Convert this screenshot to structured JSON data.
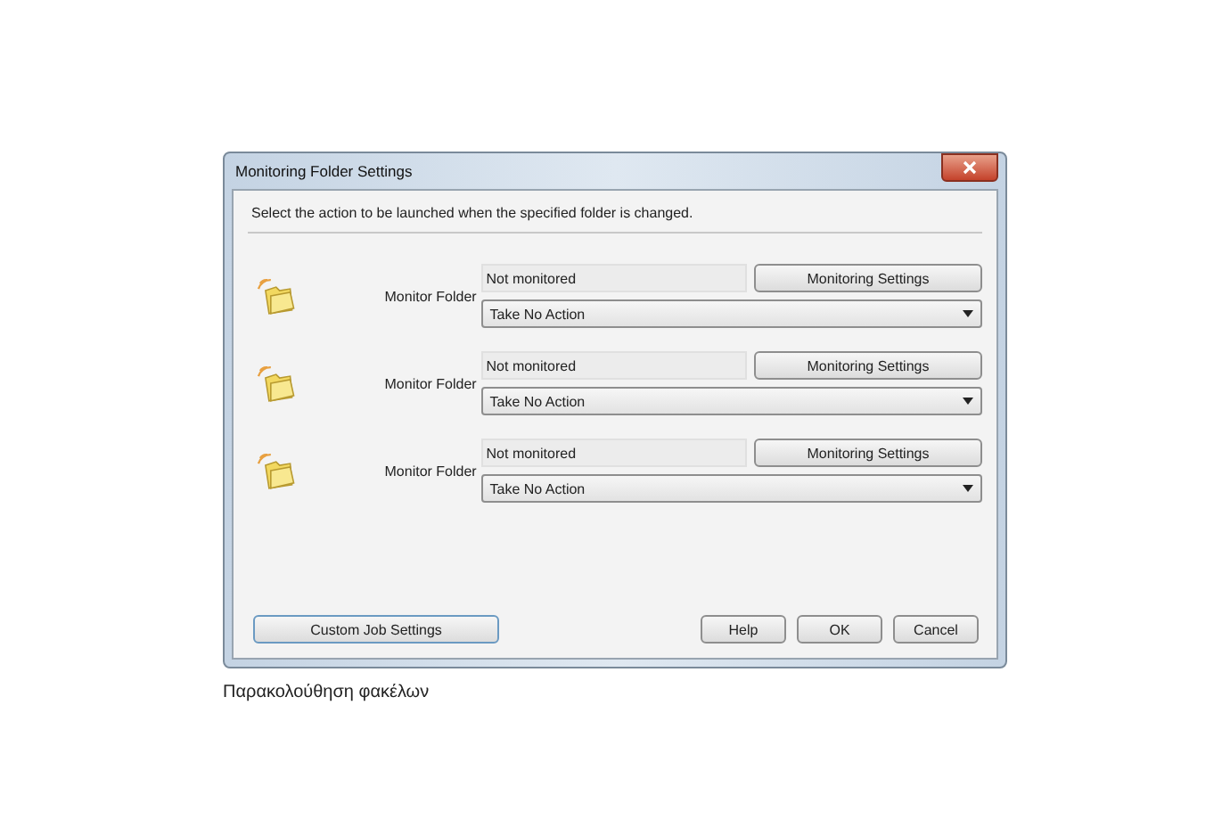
{
  "window": {
    "title": "Monitoring Folder Settings"
  },
  "instruction": "Select the action to be launched when the specified folder is changed.",
  "folders": [
    {
      "label": "Monitor Folder",
      "status": "Not monitored",
      "settings_button": "Monitoring Settings",
      "action": "Take No Action"
    },
    {
      "label": "Monitor Folder",
      "status": "Not monitored",
      "settings_button": "Monitoring Settings",
      "action": "Take No Action"
    },
    {
      "label": "Monitor Folder",
      "status": "Not monitored",
      "settings_button": "Monitoring Settings",
      "action": "Take No Action"
    }
  ],
  "custom_button": "Custom Job Settings",
  "buttons": [
    "Help",
    "OK",
    "Cancel"
  ],
  "caption": "Παρακολούθηση φακέλων"
}
